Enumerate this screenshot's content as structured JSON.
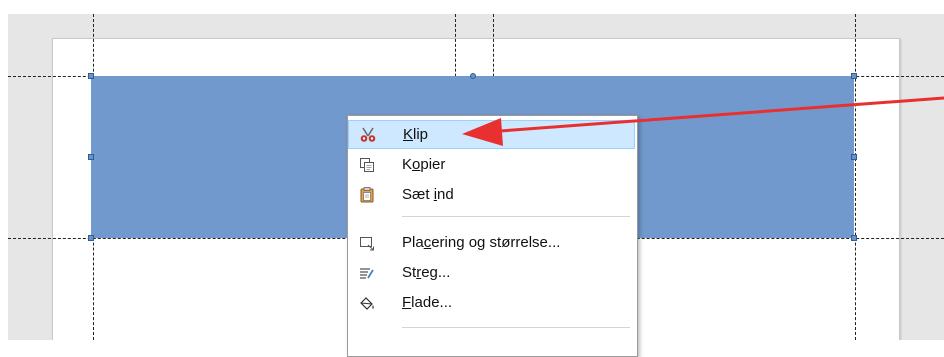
{
  "context_menu": {
    "items": [
      {
        "label": "Klip",
        "mnemonic": "K",
        "icon": "scissors-icon",
        "highlighted": true
      },
      {
        "label": "Kopier",
        "mnemonic": "o",
        "icon": "copy-icon"
      },
      {
        "label": "Sæt ind",
        "mnemonic": "i",
        "icon": "paste-icon"
      },
      {
        "label": "Placering og størrelse...",
        "mnemonic": "c",
        "icon": "position-size-icon"
      },
      {
        "label": "Streg...",
        "mnemonic": "r",
        "icon": "line-icon"
      },
      {
        "label": "Flade...",
        "mnemonic": "F",
        "icon": "area-fill-icon"
      }
    ]
  },
  "colors": {
    "shape_fill": "#7299cd",
    "menu_highlight": "#cde8ff",
    "arrow": "#e83030"
  }
}
